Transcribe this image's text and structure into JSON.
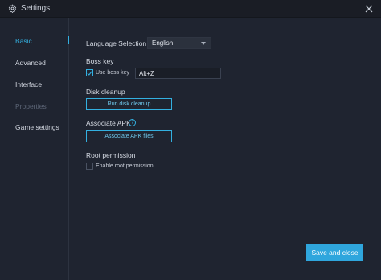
{
  "window": {
    "title": "Settings",
    "icon": "gear-icon",
    "close_icon": "close-icon"
  },
  "sidebar": {
    "items": [
      {
        "label": "Basic",
        "state": "active"
      },
      {
        "label": "Advanced",
        "state": "normal"
      },
      {
        "label": "Interface",
        "state": "normal"
      },
      {
        "label": "Properties",
        "state": "disabled"
      },
      {
        "label": "Game settings",
        "state": "normal"
      }
    ]
  },
  "basic": {
    "language_label": "Language Selection",
    "language_value": "English",
    "boss_key_label": "Boss key",
    "use_boss_key_label": "Use boss key",
    "use_boss_key_checked": true,
    "boss_key_value": "Alt+Z",
    "disk_cleanup_label": "Disk cleanup",
    "disk_cleanup_button": "Run disk cleanup",
    "associate_apk_label": "Associate APK",
    "associate_apk_button": "Associate APK files",
    "root_permission_label": "Root permission",
    "enable_root_label": "Enable root permission",
    "enable_root_checked": false
  },
  "footer": {
    "save_label": "Save and close"
  },
  "colors": {
    "accent": "#33b0e0",
    "background": "#1f2430",
    "titlebar": "#1a1d25",
    "primary_button": "#2fa6dd"
  }
}
